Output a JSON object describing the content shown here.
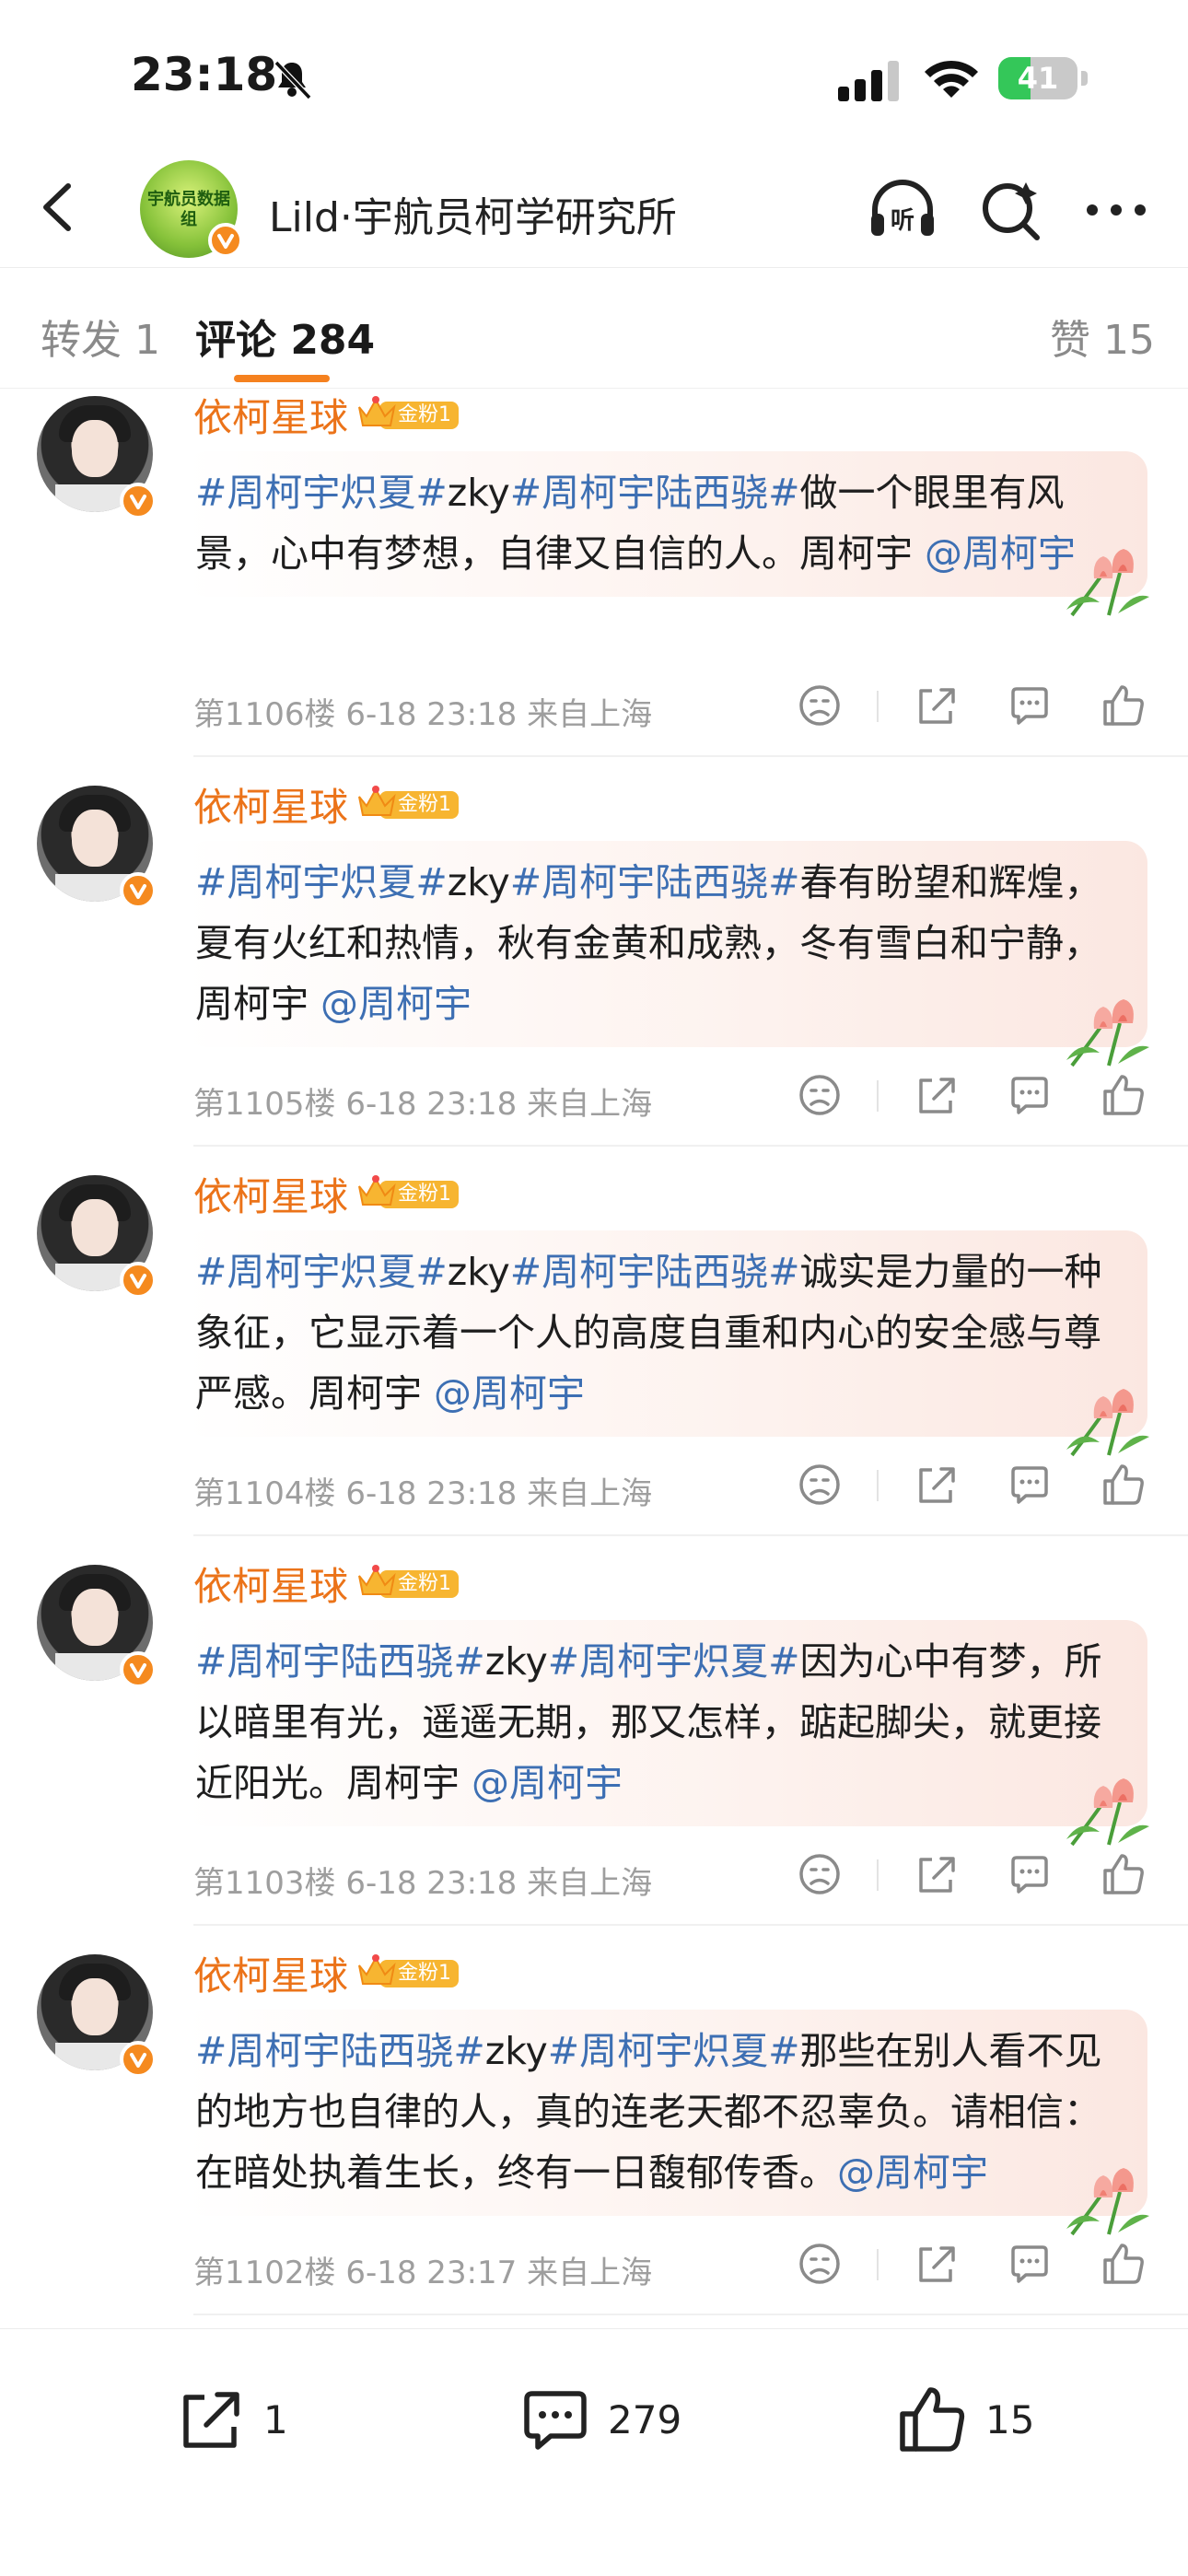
{
  "status_bar": {
    "time": "23:18",
    "battery_percent": 41,
    "battery_label": "41"
  },
  "header": {
    "title": "Lild·宇航员柯学研究所",
    "avatar_text": "宇航员数据组"
  },
  "tabs": [
    {
      "label": "转发 1"
    },
    {
      "label": "评论 284"
    },
    {
      "label": "赞 15"
    }
  ],
  "comments": [
    {
      "user": "依柯星球",
      "fan_badge": "金粉1",
      "parts": [
        {
          "t": "tag",
          "v": "#周柯宇炽夏#"
        },
        {
          "t": "text",
          "v": "zky"
        },
        {
          "t": "tag",
          "v": "#周柯宇陆西骁#"
        },
        {
          "t": "text",
          "v": "做一个眼里有风景，心中有梦想，自律又自信的人。周柯宇 "
        },
        {
          "t": "at",
          "v": "@周柯宇"
        }
      ],
      "meta": "第1106楼 6-18 23:18 来自上海"
    },
    {
      "user": "依柯星球",
      "fan_badge": "金粉1",
      "parts": [
        {
          "t": "tag",
          "v": "#周柯宇炽夏#"
        },
        {
          "t": "text",
          "v": "zky"
        },
        {
          "t": "tag",
          "v": "#周柯宇陆西骁#"
        },
        {
          "t": "text",
          "v": "春有盼望和辉煌，夏有火红和热情，秋有金黄和成熟，冬有雪白和宁静，周柯宇 "
        },
        {
          "t": "at",
          "v": "@周柯宇"
        }
      ],
      "meta": "第1105楼 6-18 23:18 来自上海"
    },
    {
      "user": "依柯星球",
      "fan_badge": "金粉1",
      "parts": [
        {
          "t": "tag",
          "v": "#周柯宇炽夏#"
        },
        {
          "t": "text",
          "v": "zky"
        },
        {
          "t": "tag",
          "v": "#周柯宇陆西骁#"
        },
        {
          "t": "text",
          "v": "诚实是力量的一种象征，它显示着一个人的高度自重和内心的安全感与尊严感。周柯宇 "
        },
        {
          "t": "at",
          "v": "@周柯宇"
        }
      ],
      "meta": "第1104楼 6-18 23:18 来自上海"
    },
    {
      "user": "依柯星球",
      "fan_badge": "金粉1",
      "parts": [
        {
          "t": "tag",
          "v": "#周柯宇陆西骁#"
        },
        {
          "t": "text",
          "v": "zky"
        },
        {
          "t": "tag",
          "v": "#周柯宇炽夏#"
        },
        {
          "t": "text",
          "v": "因为心中有梦，所以暗里有光，遥遥无期，那又怎样，踮起脚尖，就更接近阳光。周柯宇 "
        },
        {
          "t": "at",
          "v": "@周柯宇"
        }
      ],
      "meta": "第1103楼 6-18 23:18 来自上海"
    },
    {
      "user": "依柯星球",
      "fan_badge": "金粉1",
      "parts": [
        {
          "t": "tag",
          "v": "#周柯宇陆西骁#"
        },
        {
          "t": "text",
          "v": "zky"
        },
        {
          "t": "tag",
          "v": "#周柯宇炽夏#"
        },
        {
          "t": "text",
          "v": "那些在别人看不见的地方也自律的人，真的连老天都不忍辜负。请相信：在暗处执着生长，终有一日馥郁传香。"
        },
        {
          "t": "at",
          "v": "@周柯宇"
        }
      ],
      "meta": "第1102楼 6-18 23:17 来自上海"
    }
  ],
  "bottom_bar": {
    "repost_count": "1",
    "comment_count": "279",
    "like_count": "15"
  },
  "icons": {
    "back": "chevron-left-icon",
    "listen": "headphones-icon",
    "search": "search-icon",
    "more": "more-icon",
    "dislike": "frown-icon",
    "share": "share-icon",
    "comment": "comment-icon",
    "like": "thumbs-up-icon",
    "verified": "verified-v-icon",
    "fan_crown": "crown-icon",
    "flower": "tulip-icon"
  },
  "colors": {
    "accent": "#f5811f",
    "username": "#eb7319",
    "link": "#3d6fb3",
    "meta": "#9e9e9e"
  }
}
